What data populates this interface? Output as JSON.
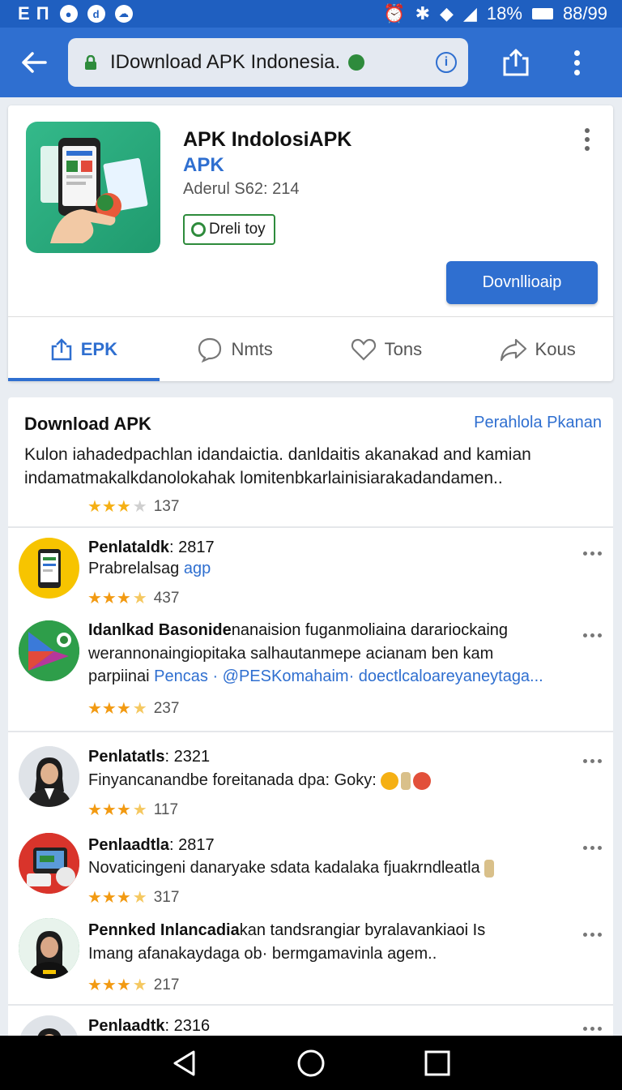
{
  "status": {
    "carrier": "E П",
    "battery": "18%",
    "time": "88/99"
  },
  "browser": {
    "url": "IDownload APK Indonesia."
  },
  "app": {
    "title": "APK IndolosiAPK",
    "subtitle": "APK",
    "meta": "Aderul S62: 214",
    "chip": "Dreli toy",
    "download_label": "Dovnllioaip"
  },
  "tabs": [
    {
      "label": "EPK",
      "icon": "share-icon"
    },
    {
      "label": "Nmts",
      "icon": "chat-icon"
    },
    {
      "label": "Tons",
      "icon": "heart-icon"
    },
    {
      "label": "Kous",
      "icon": "forward-icon"
    }
  ],
  "section": {
    "title": "Download APK",
    "link": "Perahlola Pkanan",
    "desc": "Kulon iahadedpachlan idandaictia. danldaitis akanakad and kamian indamatmakalkdanolokahak lomitenbkarlainisiarakadandamen..",
    "rating_count": "137"
  },
  "items": [
    {
      "title_bold": "Penlataldk",
      "title_rest": ": 2817",
      "text": "Prabrelalsag ",
      "text_link": "agp",
      "rating_count": "437"
    },
    {
      "title_bold": "Idanlkad Basonide",
      "title_rest": "nanaision fuganmoliaina darariockaing",
      "line2": "werannonaingiopitaka salhautanmepe acianam ben kam",
      "line3a": "parpiinai ",
      "line3b": "Pencas",
      "line3c": "  · @PESKomahaim· doectlcaloareyaneytaga...",
      "rating_count": "237"
    },
    {
      "title_bold": "Penlatatls",
      "title_rest": ": 2321",
      "text": "Finyancanandbe foreitanada dpa: Goky:",
      "rating_count": "117"
    },
    {
      "title_bold": "Penlaadtla",
      "title_rest": ": 2817",
      "text": "Novaticingeni danaryake sdata kadalaka fjuakrndleatla",
      "rating_count": "317"
    },
    {
      "title_bold": "Pennked Inlancadia",
      "title_rest": "kan tandsrangiar byralavankiaoi Is",
      "text": "Imang afanakaydaga ob· bermgamavinla agem..",
      "rating_count": "217"
    },
    {
      "title_bold": "Penlaadtk",
      "title_rest": ": 2316"
    }
  ],
  "colors": {
    "primary": "#2f6fd0",
    "statusbar": "#1f5fc0",
    "star": "#f5b014",
    "green": "#2e8b3c"
  }
}
